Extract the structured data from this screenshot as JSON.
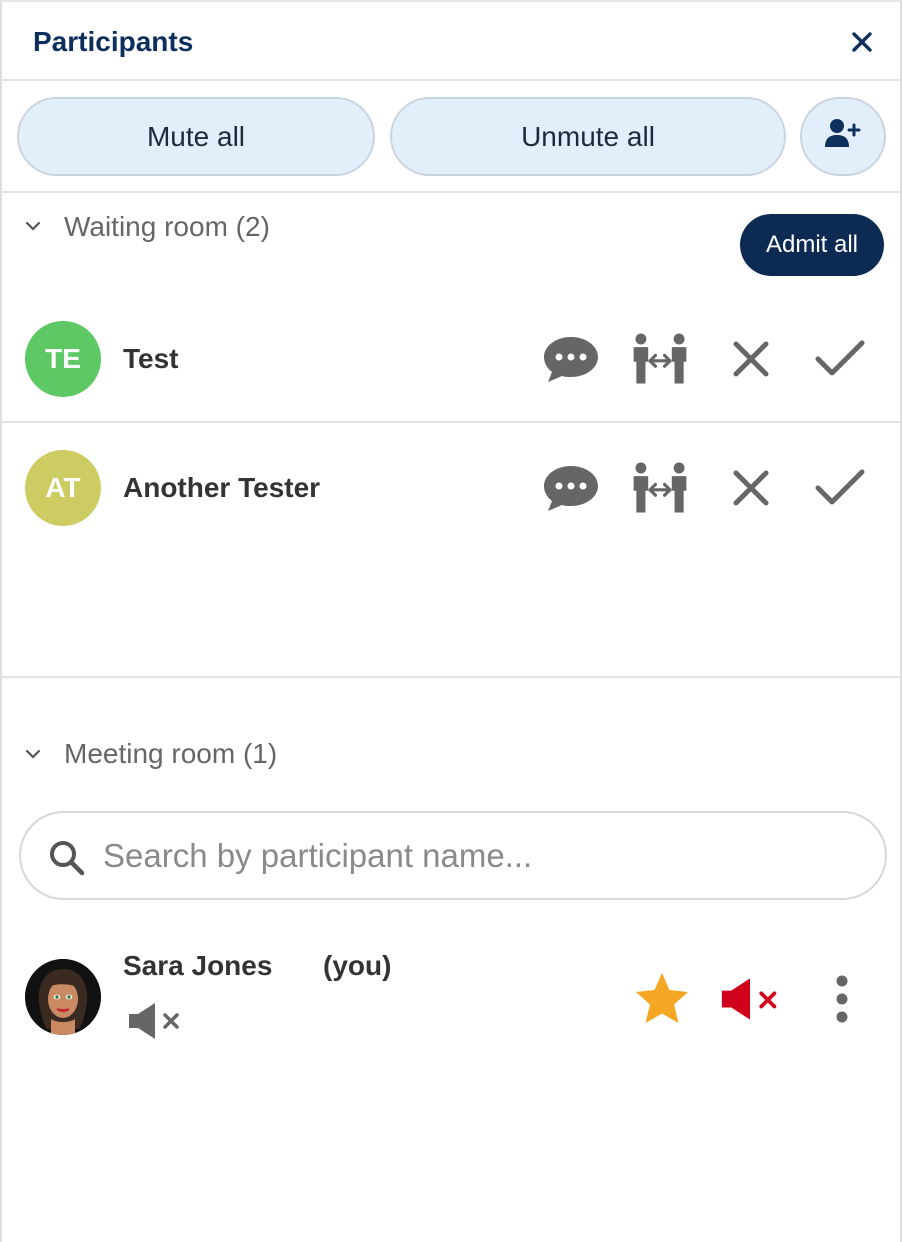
{
  "header": {
    "title": "Participants",
    "close_icon": "close-icon"
  },
  "toolbar": {
    "mute_all": "Mute all",
    "unmute_all": "Unmute all",
    "invite_icon": "add-person-icon"
  },
  "waiting_room": {
    "title": "Waiting room (2)",
    "admit_all": "Admit all",
    "participants": [
      {
        "initials": "TE",
        "name": "Test",
        "avatar_color": "#5ec964"
      },
      {
        "initials": "AT",
        "name": "Another Tester",
        "avatar_color": "#cccc63"
      }
    ]
  },
  "meeting_room": {
    "title": "Meeting room (1)",
    "search_placeholder": "Search by participant name...",
    "participants": [
      {
        "name": "Sara Jones",
        "you_label": "(you)",
        "star_color": "#f5a623",
        "muted_color": "#d0021b"
      }
    ]
  },
  "colors": {
    "primary": "#0d2f5c",
    "pill_bg": "#e2effb",
    "icon_gray": "#666666"
  }
}
